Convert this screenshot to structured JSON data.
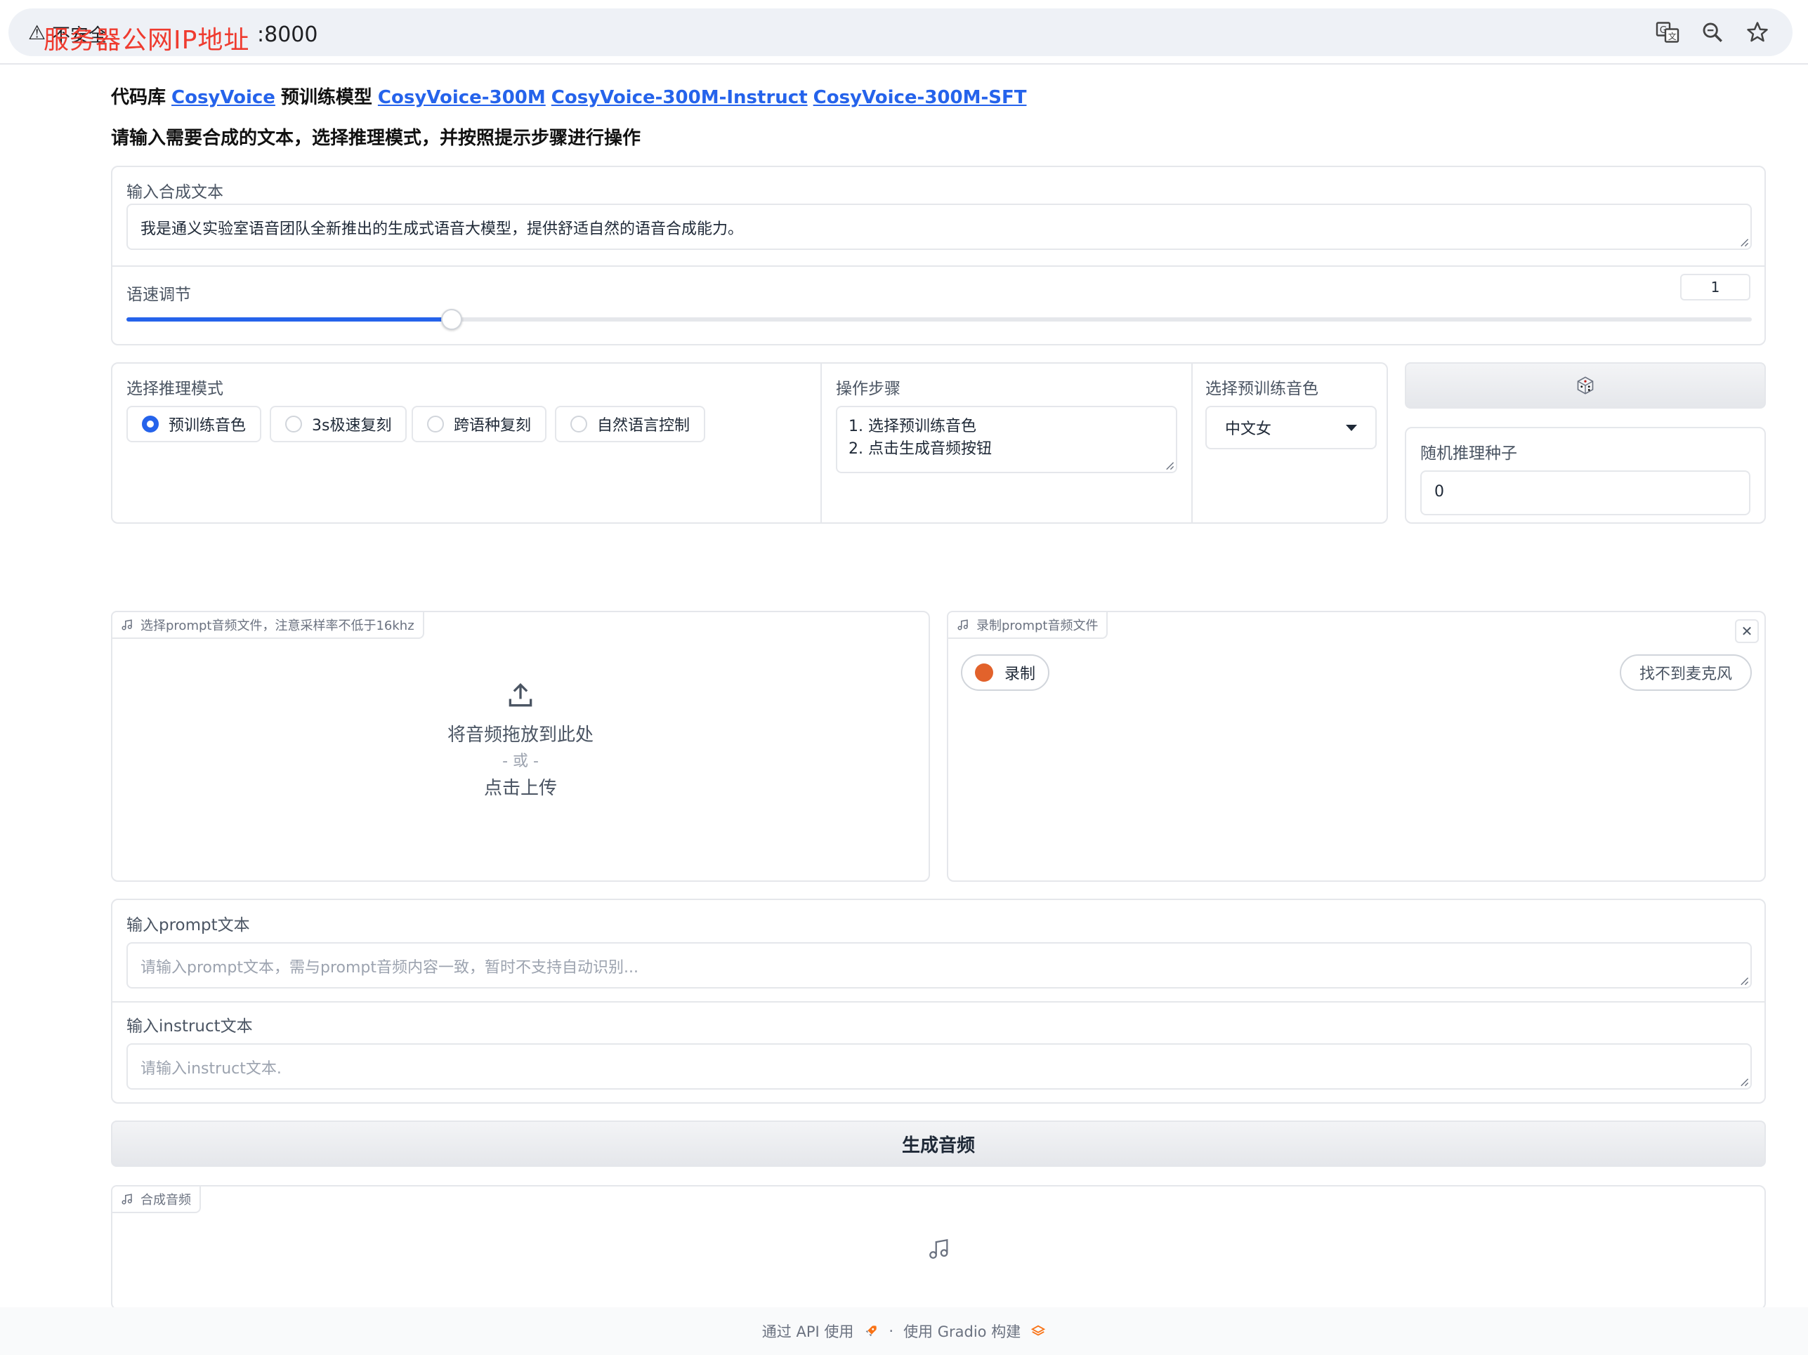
{
  "browser": {
    "warning_icon": "warning-triangle-icon",
    "security_label": "不安全",
    "overlay_text": "服务器公网IP地址",
    "port": ":8000",
    "icons": [
      "translate-icon",
      "zoom-icon",
      "bookmark-star-icon"
    ]
  },
  "header": {
    "code_label": "代码库",
    "code_link": "CosyVoice",
    "pretrained_label": "预训练模型",
    "models": [
      "CosyVoice-300M",
      "CosyVoice-300M-Instruct",
      "CosyVoice-300M-SFT"
    ],
    "subtitle": "请输入需要合成的文本，选择推理模式，并按照提示步骤进行操作"
  },
  "synth_text": {
    "label": "输入合成文本",
    "value": "我是通义实验室语音团队全新推出的生成式语音大模型，提供舒适自然的语音合成能力。"
  },
  "speed": {
    "label": "语速调节",
    "value": "1",
    "fill_fraction": 0.2
  },
  "mode": {
    "label": "选择推理模式",
    "options": [
      "预训练音色",
      "3s极速复刻",
      "跨语种复刻",
      "自然语言控制"
    ],
    "selected": 0
  },
  "steps": {
    "label": "操作步骤",
    "lines": [
      "1. 选择预训练音色",
      "2. 点击生成音频按钮"
    ]
  },
  "voice": {
    "label": "选择预训练音色",
    "value": "中文女"
  },
  "seed": {
    "dice_icon": "dice-icon",
    "label": "随机推理种子",
    "value": "0"
  },
  "upload": {
    "tag": "选择prompt音频文件，注意采样率不低于16khz",
    "drop_text": "将音频拖放到此处",
    "or_text": "- 或 -",
    "click_text": "点击上传"
  },
  "record": {
    "tag": "录制prompt音频文件",
    "record_label": "录制",
    "no_mic_label": "找不到麦克风"
  },
  "prompt_text": {
    "label": "输入prompt文本",
    "placeholder": "请输入prompt文本，需与prompt音频内容一致，暂时不支持自动识别..."
  },
  "instruct_text": {
    "label": "输入instruct文本",
    "placeholder": "请输入instruct文本."
  },
  "generate": {
    "label": "生成音频"
  },
  "output": {
    "tag": "合成音频"
  },
  "footer": {
    "api_label": "通过 API 使用",
    "sep": "·",
    "gradio_label": "使用 Gradio 构建"
  },
  "colors": {
    "accent": "#2563eb",
    "record": "#e2622b",
    "overlay": "#ef3b2f"
  }
}
